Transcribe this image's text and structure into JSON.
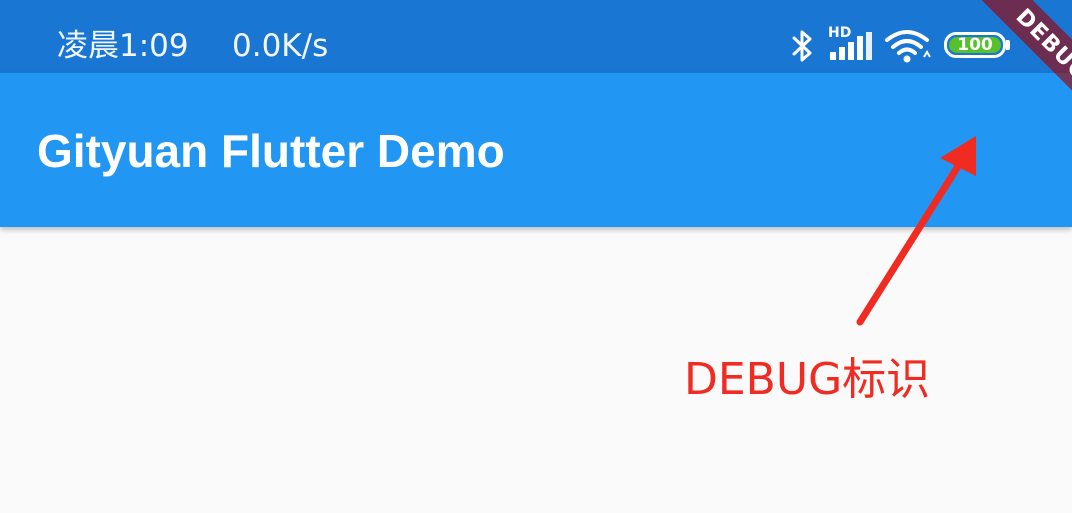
{
  "status_bar": {
    "time": "凌晨1:09",
    "network_speed": "0.0K/s",
    "icons": [
      "bluetooth-icon",
      "hd-signal-icon",
      "wifi-icon",
      "battery-icon"
    ],
    "hd_label": "HD",
    "battery_level": "100",
    "battery_fraction": 1.0,
    "color": "#1976d2",
    "battery_color": "#56c12b"
  },
  "app_bar": {
    "title": "Gityuan Flutter Demo",
    "color": "#2196f3"
  },
  "debug_banner": {
    "label": "DEBUG"
  },
  "annotation": {
    "label": "DEBUG标识",
    "color": "#ef2b22"
  },
  "body": {
    "background": "#fafafa"
  }
}
